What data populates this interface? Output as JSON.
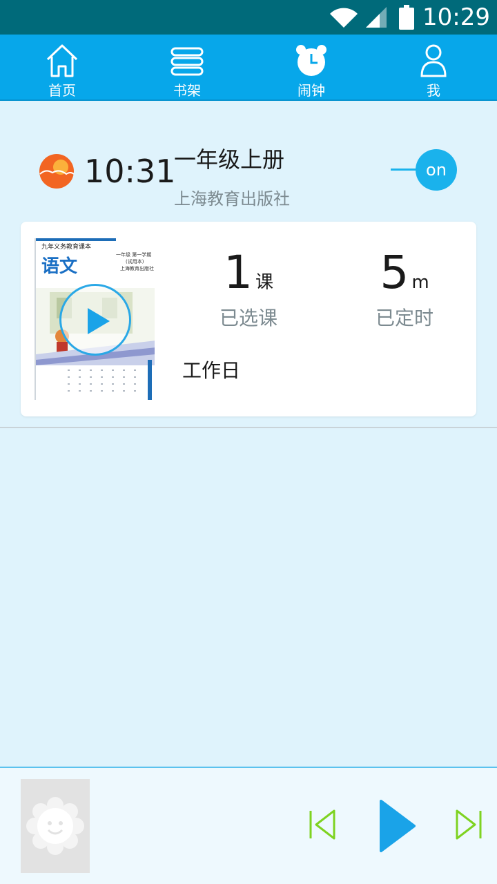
{
  "status_bar": {
    "time": "10:29"
  },
  "nav": {
    "items": [
      {
        "label": "首页",
        "icon": "home-icon"
      },
      {
        "label": "书架",
        "icon": "bookshelf-icon"
      },
      {
        "label": "闹钟",
        "icon": "alarm-clock-icon"
      },
      {
        "label": "我",
        "icon": "user-icon"
      }
    ]
  },
  "alarm": {
    "time": "10:31",
    "title": "一年级上册",
    "publisher": "上海教育出版社",
    "toggle_label": "on",
    "toggle_state": "on"
  },
  "card": {
    "cover": {
      "series": "九年义务教育课本",
      "subject": "语文",
      "grade": "一年级 第一学期",
      "trial": "(试用本)",
      "publisher": "上海教育出版社"
    },
    "lessons": {
      "value": "1",
      "unit": "课",
      "caption": "已选课"
    },
    "duration": {
      "value": "5",
      "unit": "m",
      "caption": "已定时"
    },
    "repeat": "工作日"
  },
  "player": {
    "thumbnail": "smiley-flower-icon",
    "controls": [
      "previous-icon",
      "play-icon",
      "next-icon"
    ]
  },
  "colors": {
    "status_bar": "#006a7a",
    "nav_bar": "#07a7ea",
    "background": "#dff3fc",
    "accent": "#1ab2ec",
    "player_controls": "#7ed321"
  }
}
